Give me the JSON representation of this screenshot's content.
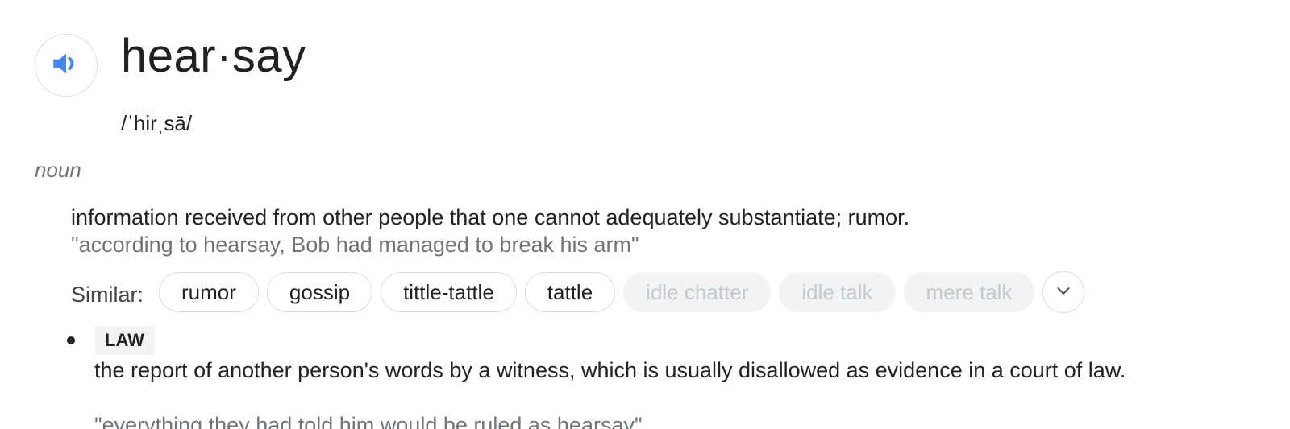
{
  "entry": {
    "word": "hear·say",
    "phonetic": "/ˈhirˌsā/",
    "part_of_speech": "noun",
    "audio_icon": "speaker-icon"
  },
  "sense1": {
    "definition": "information received from other people that one cannot adequately substantiate; rumor.",
    "example": "\"according to hearsay, Bob had managed to break his arm\"",
    "similar_label": "Similar:",
    "similar": [
      {
        "label": "rumor",
        "faded": false
      },
      {
        "label": "gossip",
        "faded": false
      },
      {
        "label": "tittle-tattle",
        "faded": false
      },
      {
        "label": "tattle",
        "faded": false
      },
      {
        "label": "idle chatter",
        "faded": true
      },
      {
        "label": "idle talk",
        "faded": true
      },
      {
        "label": "mere talk",
        "faded": true
      }
    ],
    "expand_icon": "chevron-down-icon"
  },
  "sense2": {
    "domain_label": "LAW",
    "definition": "the report of another person's words by a witness, which is usually disallowed as evidence in a court of law.",
    "example": "\"everything they had told him would be ruled as hearsay\""
  },
  "colors": {
    "accent_blue": "#4285f4",
    "muted_text": "#70757a",
    "chip_border": "#dadce0",
    "faded_chip_bg": "#f1f3f4"
  }
}
